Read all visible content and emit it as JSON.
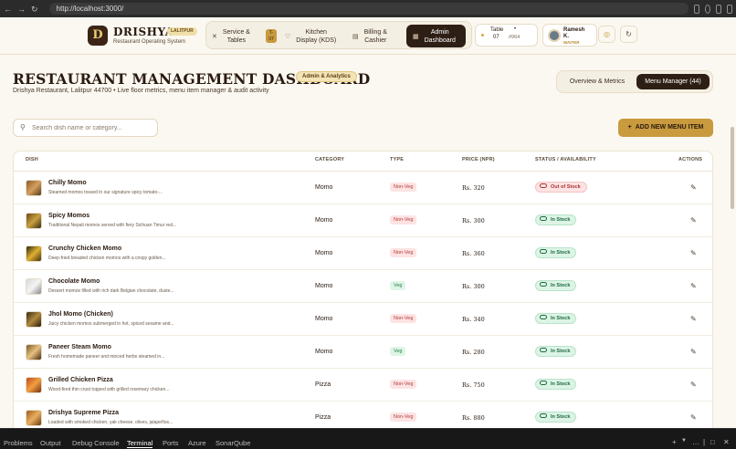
{
  "browser": {
    "url": "http://localhost:3000/"
  },
  "header": {
    "logo_letter": "D",
    "brand": "DRISHYA",
    "brand_badge": "LALITPUR",
    "brand_sub": "Restaurant Operating System",
    "nav": [
      {
        "label_line1": "Service &",
        "label_line2": "Tables",
        "icon": "utensils-icon",
        "kbd1": "T-",
        "kbd2": "07"
      },
      {
        "label_line1": "Kitchen",
        "label_line2": "Display (KDS)",
        "icon": "chef-hat-icon"
      },
      {
        "label_line1": "Billing &",
        "label_line2": "Cashier",
        "icon": "receipt-icon"
      },
      {
        "label_line1": "Admin",
        "label_line2": "Dashboard",
        "icon": "grid-icon",
        "active": true
      }
    ],
    "table": {
      "label": "Table",
      "number": "07",
      "order": "#964"
    },
    "user": {
      "name_line1": "Ramesh",
      "name_line2": "K.",
      "role": "WAITER"
    }
  },
  "page": {
    "title": "RESTAURANT MANAGEMENT DASHBOARD",
    "title_badge": "Admin & Analytics",
    "subtitle": "Drishya Restaurant, Lalitpur 44700 • Live floor metrics, menu item manager & audit activity",
    "tabs": [
      "Overview & Metrics",
      "Menu Manager (44)"
    ],
    "active_tab": 1
  },
  "search": {
    "placeholder": "Search dish name or category..."
  },
  "add_button": {
    "label": "ADD NEW MENU ITEM"
  },
  "table": {
    "columns": [
      "DISH",
      "CATEGORY",
      "TYPE",
      "PRICE (NPR)",
      "STATUS / AVAILABILITY",
      "ACTIONS"
    ],
    "rows": [
      {
        "name": "Chilly Momo",
        "desc": "Steamed momos tossed in our signature spicy tomato-...",
        "category": "Momo",
        "type": "Non-Veg",
        "price": "Rs. 320",
        "status": "Out of Stock"
      },
      {
        "name": "Spicy Momos",
        "desc": "Traditional Nepali momos served with fiery Sichuan Timur red...",
        "category": "Momo",
        "type": "Non-Veg",
        "price": "Rs. 300",
        "status": "In Stock"
      },
      {
        "name": "Crunchy Chicken Momo",
        "desc": "Deep-fried breaded chicken momos with a crispy golden...",
        "category": "Momo",
        "type": "Non-Veg",
        "price": "Rs. 360",
        "status": "In Stock"
      },
      {
        "name": "Chocolate Momo",
        "desc": "Dessert momos filled with rich dark Belgian chocolate, duste...",
        "category": "Momo",
        "type": "Veg",
        "price": "Rs. 300",
        "status": "In Stock"
      },
      {
        "name": "Jhol Momo (Chicken)",
        "desc": "Juicy chicken momos submerged in hot, spiced sesame and...",
        "category": "Momo",
        "type": "Non-Veg",
        "price": "Rs. 340",
        "status": "In Stock"
      },
      {
        "name": "Paneer Steam Momo",
        "desc": "Fresh homemade paneer and minced herbs steamed in...",
        "category": "Momo",
        "type": "Veg",
        "price": "Rs. 280",
        "status": "In Stock"
      },
      {
        "name": "Grilled Chicken Pizza",
        "desc": "Wood-fired thin crust topped with grilled rosemary chicken...",
        "category": "Pizza",
        "type": "Non-Veg",
        "price": "Rs. 750",
        "status": "In Stock"
      },
      {
        "name": "Drishya Supreme Pizza",
        "desc": "Loaded with smoked chicken, yak cheese, olives, jalapeños...",
        "category": "Pizza",
        "type": "Non-Veg",
        "price": "Rs. 880",
        "status": "In Stock"
      }
    ]
  },
  "statusbar": {
    "tabs": [
      "Problems",
      "Output",
      "Debug Console",
      "Terminal",
      "Ports",
      "Azure",
      "SonarQube"
    ],
    "active": "Terminal"
  }
}
